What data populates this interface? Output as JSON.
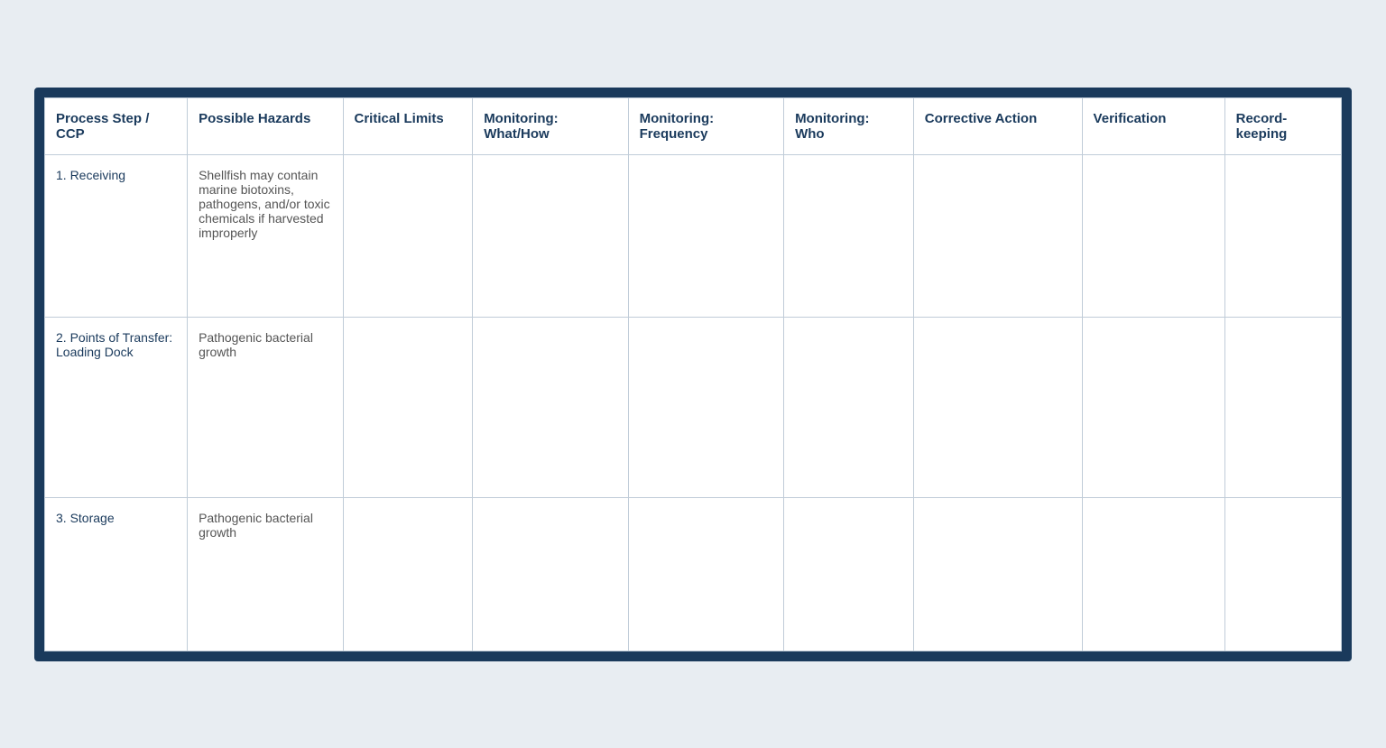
{
  "table": {
    "headers": [
      {
        "id": "process-step",
        "label": "Process Step / CCP"
      },
      {
        "id": "possible-hazards",
        "label": "Possible Hazards"
      },
      {
        "id": "critical-limits",
        "label": "Critical Limits"
      },
      {
        "id": "monitoring-what",
        "label": "Monitoring: What/How"
      },
      {
        "id": "monitoring-frequency",
        "label": "Monitoring: Frequency"
      },
      {
        "id": "monitoring-who",
        "label": "Monitoring: Who"
      },
      {
        "id": "corrective-action",
        "label": "Corrective Action"
      },
      {
        "id": "verification",
        "label": "Verification"
      },
      {
        "id": "recordkeeping",
        "label": "Record-keeping"
      }
    ],
    "rows": [
      {
        "id": "row-1",
        "process_step": "1.   Receiving",
        "possible_hazards": "Shellfish may contain marine biotoxins, pathogens, and/or toxic chemicals if harvested improperly",
        "critical_limits": "",
        "monitoring_what": "",
        "monitoring_frequency": "",
        "monitoring_who": "",
        "corrective_action": "",
        "verification": "",
        "recordkeeping": ""
      },
      {
        "id": "row-2",
        "process_step": "2.   Points of Transfer: Loading Dock",
        "possible_hazards": "Pathogenic bacterial growth",
        "critical_limits": "",
        "monitoring_what": "",
        "monitoring_frequency": "",
        "monitoring_who": "",
        "corrective_action": "",
        "verification": "",
        "recordkeeping": ""
      },
      {
        "id": "row-3",
        "process_step": "3.   Storage",
        "possible_hazards": "Pathogenic bacterial growth",
        "critical_limits": "",
        "monitoring_what": "",
        "monitoring_frequency": "",
        "monitoring_who": "",
        "corrective_action": "",
        "verification": "",
        "recordkeeping": ""
      }
    ]
  }
}
